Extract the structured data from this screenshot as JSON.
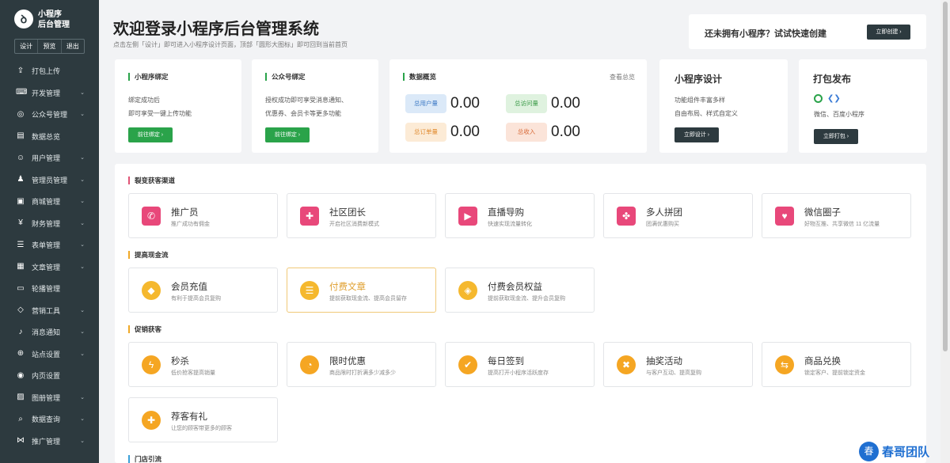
{
  "sidebar": {
    "app_title_line1": "小程序",
    "app_title_line2": "后台管理",
    "logo_glyph": "ꝺ",
    "top_actions": [
      "设计",
      "预览",
      "退出"
    ],
    "items": [
      {
        "label": "打包上传",
        "icon": "upload-icon",
        "has_chevron": false
      },
      {
        "label": "开发管理",
        "icon": "code-icon",
        "has_chevron": true
      },
      {
        "label": "公众号管理",
        "icon": "wechat-icon",
        "has_chevron": true
      },
      {
        "label": "数据总览",
        "icon": "chart-icon",
        "has_chevron": false
      },
      {
        "label": "用户管理",
        "icon": "user-icon",
        "has_chevron": true
      },
      {
        "label": "管理员管理",
        "icon": "admin-icon",
        "has_chevron": true
      },
      {
        "label": "商城管理",
        "icon": "shop-icon",
        "has_chevron": true
      },
      {
        "label": "财务管理",
        "icon": "finance-icon",
        "has_chevron": true
      },
      {
        "label": "表单管理",
        "icon": "form-icon",
        "has_chevron": true
      },
      {
        "label": "文章管理",
        "icon": "article-icon",
        "has_chevron": true
      },
      {
        "label": "轮播管理",
        "icon": "carousel-icon",
        "has_chevron": false
      },
      {
        "label": "营销工具",
        "icon": "marketing-icon",
        "has_chevron": true
      },
      {
        "label": "消息通知",
        "icon": "bell-icon",
        "has_chevron": true
      },
      {
        "label": "站点设置",
        "icon": "globe-icon",
        "has_chevron": true
      },
      {
        "label": "内页设置",
        "icon": "page-icon",
        "has_chevron": false
      },
      {
        "label": "图册管理",
        "icon": "image-icon",
        "has_chevron": true
      },
      {
        "label": "数据查询",
        "icon": "search-data-icon",
        "has_chevron": true
      },
      {
        "label": "推广管理",
        "icon": "share-icon",
        "has_chevron": true
      }
    ]
  },
  "header": {
    "title": "欢迎登录小程序后台管理系统",
    "subtitle": "点击左侧「设计」即可进入小程序设计页面，顶部「圆形大图标」即可回到当前首页"
  },
  "create_promo": {
    "text": "还未拥有小程序？试试快速创建",
    "button": "立即创建 ›"
  },
  "cards": {
    "miniapp_bind": {
      "title": "小程序绑定",
      "line1": "绑定成功后",
      "line2": "即可享受一键上传功能",
      "button": "前往绑定 ›"
    },
    "official_bind": {
      "title": "公众号绑定",
      "line1": "授权成功即可享受消息通知、",
      "line2": "优惠券、会员卡等更多功能",
      "button": "前往绑定 ›"
    },
    "overview": {
      "title": "数据概览",
      "link": "查看总览",
      "stats": [
        {
          "label": "总用户量",
          "value": "0.00",
          "color": "#dbe9f8",
          "text_color": "#3b78c4"
        },
        {
          "label": "总访问量",
          "value": "0.00",
          "color": "#dff2df",
          "text_color": "#3a9a47"
        },
        {
          "label": "总订单量",
          "value": "0.00",
          "color": "#fcebd6",
          "text_color": "#e08a2e"
        },
        {
          "label": "总收入",
          "value": "0.00",
          "color": "#fbe4d9",
          "text_color": "#d96c3a"
        }
      ]
    },
    "design": {
      "title": "小程序设计",
      "line1": "功能组件丰富多样",
      "line2": "自由布局、样式自定义",
      "button": "立即设计 ›"
    },
    "publish": {
      "title": "打包发布",
      "line1": "微信、百度小程序",
      "button": "立即打包 ›"
    }
  },
  "sections": [
    {
      "title": "裂变获客渠道",
      "accent": "#e05577",
      "tiles": [
        {
          "name": "推广员",
          "desc": "推广成功有佣金",
          "icon": "megaphone-icon",
          "color": "#e8487a"
        },
        {
          "name": "社区团长",
          "desc": "开启社区消费新模式",
          "icon": "user-plus-icon",
          "color": "#e8487a"
        },
        {
          "name": "直播导购",
          "desc": "快速实现流量转化",
          "icon": "video-icon",
          "color": "#e8487a"
        },
        {
          "name": "多人拼团",
          "desc": "团满优惠购买",
          "icon": "puzzle-icon",
          "color": "#e8487a"
        },
        {
          "name": "微信圈子",
          "desc": "好物互推、共享微信 11 亿流量",
          "icon": "heart-icon",
          "color": "#e8487a"
        }
      ]
    },
    {
      "title": "提高现金流",
      "accent": "#f0a928",
      "tiles": [
        {
          "name": "会员充值",
          "desc": "有利于提高会员复购",
          "icon": "coin-icon",
          "color": "#f5b82e"
        },
        {
          "name": "付费文章",
          "desc": "提前获取现金流、提高会员留存",
          "icon": "document-icon",
          "color": "#f5b82e",
          "active": true
        },
        {
          "name": "付费会员权益",
          "desc": "提前获取现金流、提升会员复购",
          "icon": "diamond-icon",
          "color": "#f5b82e"
        }
      ]
    },
    {
      "title": "促销获客",
      "accent": "#f0a928",
      "tiles": [
        {
          "name": "秒杀",
          "desc": "低价抢客提高销量",
          "icon": "lightning-icon",
          "color": "#f5a623"
        },
        {
          "name": "限时优惠",
          "desc": "商品限时打折满多少减多少",
          "icon": "clock-icon",
          "color": "#f5a623"
        },
        {
          "name": "每日签到",
          "desc": "提高打开小程序活跃度存",
          "icon": "checkin-icon",
          "color": "#f5a623"
        },
        {
          "name": "抽奖活动",
          "desc": "与客户互动、提高复购",
          "icon": "gift-icon",
          "color": "#f5a623"
        },
        {
          "name": "商品兑换",
          "desc": "锁定客户、提前锁定资金",
          "icon": "exchange-icon",
          "color": "#f5a623"
        },
        {
          "name": "荐客有礼",
          "desc": "让您的顾客带更多的顾客",
          "icon": "referral-icon",
          "color": "#f5a623"
        }
      ]
    },
    {
      "title": "门店引流",
      "accent": "#3aa0d8",
      "tiles": []
    }
  ],
  "watermark": {
    "badge": "春",
    "text": "春哥团队"
  }
}
